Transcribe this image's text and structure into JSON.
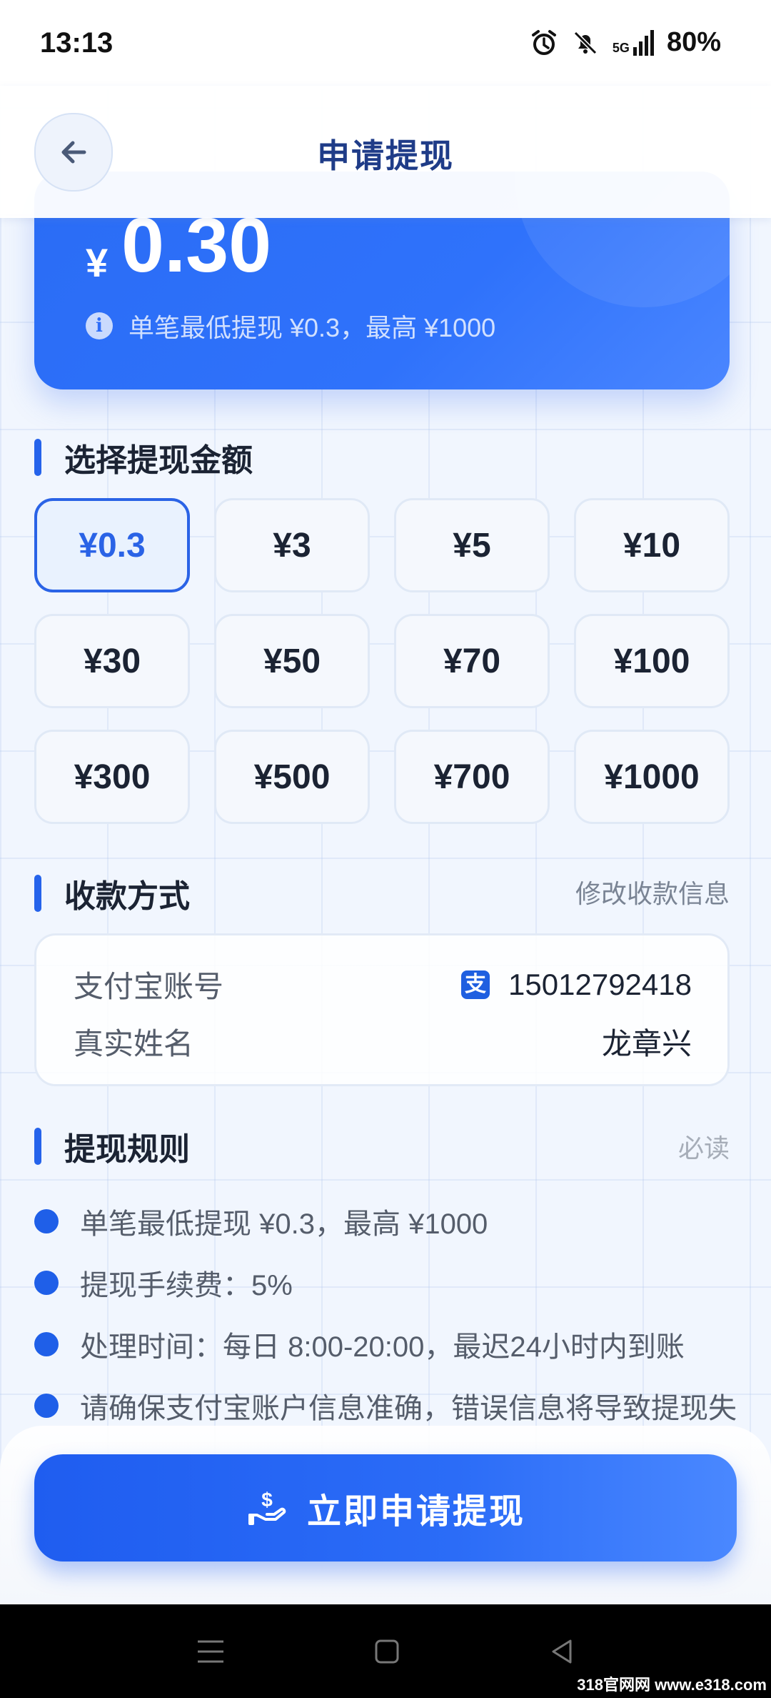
{
  "status_bar": {
    "time": "13:13",
    "battery": "80%",
    "network": "5G"
  },
  "header": {
    "title": "申请提现"
  },
  "balance": {
    "currency_symbol": "¥",
    "amount": "0.30",
    "note": "单笔最低提现 ¥0.3，最高 ¥1000"
  },
  "amount_section": {
    "title": "选择提现金额",
    "options": [
      "¥0.3",
      "¥3",
      "¥5",
      "¥10",
      "¥30",
      "¥50",
      "¥70",
      "¥100",
      "¥300",
      "¥500",
      "¥700",
      "¥1000"
    ],
    "selected": "¥0.3"
  },
  "payment_section": {
    "title": "收款方式",
    "edit_link": "修改收款信息",
    "account_label": "支付宝账号",
    "account_value": "15012792418",
    "name_label": "真实姓名",
    "name_value": "龙章兴"
  },
  "rules_section": {
    "title": "提现规则",
    "tag": "必读",
    "items": [
      "单笔最低提现 ¥0.3，最高 ¥1000",
      "提现手续费：5%",
      "处理时间：每日 8:00-20:00，最迟24小时内到账",
      "请确保支付宝账户信息准确，错误信息将导致提现失"
    ]
  },
  "submit": {
    "label": "立即申请提现"
  },
  "watermark": "318官网网 www.e318.com",
  "colors": {
    "primary": "#2563eb",
    "card_gradient_start": "#2a6cf5",
    "card_gradient_end": "#4a86ff"
  },
  "icons": {
    "back": "arrow-left-icon",
    "info": "info-icon",
    "alipay": "alipay-icon",
    "submit": "hand-money-icon"
  }
}
